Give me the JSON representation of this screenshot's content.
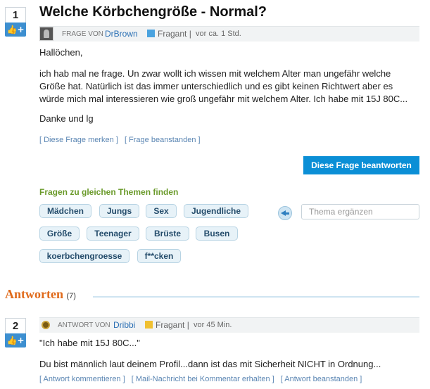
{
  "question": {
    "vote_number": "1",
    "title": "Welche Körbchengröße - Normal?",
    "meta": {
      "label": "FRAGE VON",
      "user": "DrBrown",
      "role": "Fragant |",
      "time": "vor ca. 1 Std.",
      "flag_color": "#4aa3df"
    },
    "greeting": "Hallöchen,",
    "body_line1": "ich hab mal ne frage. Un zwar wollt ich wissen mit welchem Alter man ungefähr welche",
    "body_line2": "Größe hat. Natürlich ist das immer unterschiedlich und es gibt keinen Richtwert aber es",
    "body_line3": "würde mich mal interessieren wie groß ungefähr mit welchem Alter. Ich habe mit 15J 80C...",
    "closing": "Danke und lg",
    "link_remember": "[ Diese Frage merken ]",
    "link_report": "[ Frage beanstanden ]",
    "answer_button": "Diese Frage beantworten"
  },
  "topics": {
    "title": "Fragen zu gleichen Themen finden",
    "tags": [
      "Mädchen",
      "Jungs",
      "Sex",
      "Jugendliche",
      "Größe",
      "Teenager",
      "Brüste",
      "Busen",
      "koerbchengroesse",
      "f**cken"
    ],
    "input_placeholder": "Thema ergänzen"
  },
  "answers": {
    "heading": "Antworten",
    "count": "(7)",
    "items": [
      {
        "vote_number": "2",
        "label": "ANTWORT VON",
        "user": "Dribbi",
        "role": "Fragant |",
        "time": "vor 45 Min.",
        "flag_color": "#f0c030",
        "quote": "\"Ich habe mit 15J 80C...\"",
        "text": "Du bist männlich laut deinem Profil...dann ist das mit Sicherheit NICHT in Ordnung...",
        "link_comment": "[ Antwort kommentieren ]",
        "link_mail": "[ Mail-Nachricht bei Kommentar erhalten ]",
        "link_report": "[ Antwort beanstanden ]"
      }
    ]
  }
}
